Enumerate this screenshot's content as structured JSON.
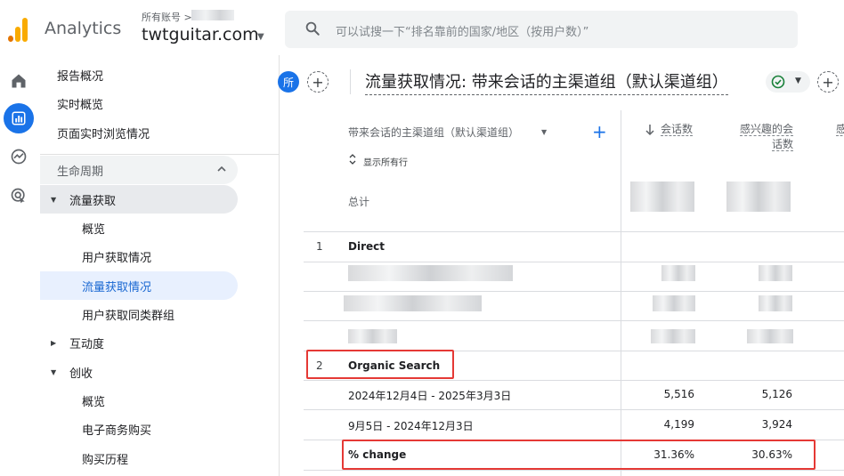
{
  "header": {
    "brand": "Analytics",
    "account_label": "所有账号 >",
    "property_name": "twtguitar.com",
    "search_placeholder": "可以试搜一下“排名靠前的国家/地区（按用户数）”"
  },
  "nav": {
    "items": [
      {
        "label": "报告概况"
      },
      {
        "label": "实时概览"
      },
      {
        "label": "页面实时浏览情况"
      },
      {
        "label": "生命周期"
      },
      {
        "label": "流量获取"
      },
      {
        "label": "概览"
      },
      {
        "label": "用户获取情况"
      },
      {
        "label": "流量获取情况"
      },
      {
        "label": "用户获取同类群组"
      },
      {
        "label": "互动度"
      },
      {
        "label": "创收"
      },
      {
        "label": "概览"
      },
      {
        "label": "电子商务购买"
      },
      {
        "label": "购买历程"
      }
    ]
  },
  "report": {
    "chip": "所",
    "title": "流量获取情况: 带来会话的主渠道组（默认渠道组）"
  },
  "table": {
    "dimension_header": "带来会话的主渠道组（默认渠道组）",
    "show_all_rows": "显示所有行",
    "metric_1": "会话数",
    "metric_2_line1": "感兴趣的会",
    "metric_2_line2": "话数",
    "metric_3": "感",
    "total_label": "总计",
    "rows": [
      {
        "num": "1",
        "label": "Direct"
      },
      {
        "num": "2",
        "label": "Organic Search"
      }
    ],
    "organic": [
      {
        "label": "2024年12月4日 - 2025年3月3日",
        "m1": "5,516",
        "m2": "5,126"
      },
      {
        "label": "9月5日 - 2024年12月3日",
        "m1": "4,199",
        "m2": "3,924"
      },
      {
        "label": "% change",
        "m1": "31.36%",
        "m2": "30.63%"
      }
    ]
  }
}
